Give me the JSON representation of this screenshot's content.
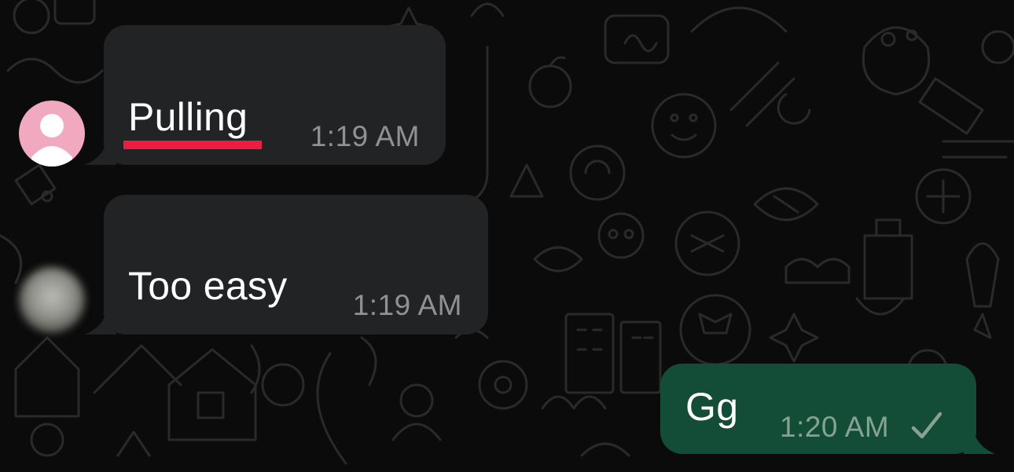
{
  "chat": {
    "messages": [
      {
        "direction": "incoming",
        "text": "Pulling",
        "time": "1:19 AM",
        "underline_color": "#ee1d3f"
      },
      {
        "direction": "incoming",
        "text": "Too easy",
        "time": "1:19 AM"
      },
      {
        "direction": "outgoing",
        "text": "Gg",
        "time": "1:20 AM",
        "status_icon": "single-check-icon"
      }
    ]
  },
  "colors": {
    "background": "#0b0b0b",
    "incoming_bubble": "#222325",
    "outgoing_bubble": "#134d37",
    "timestamp": "#8f9194",
    "avatar_placeholder": "#f0a9bf"
  }
}
